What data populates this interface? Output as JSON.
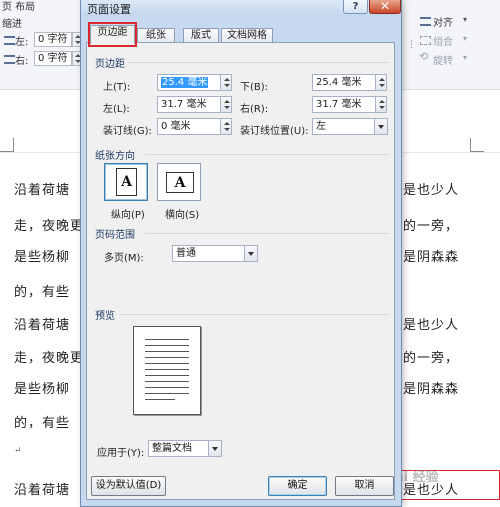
{
  "ribbon": {
    "tab_partial": "页  布局",
    "indent_label": "缩进",
    "left_label": "左:",
    "left_value": "0 字符",
    "right_label": "右:",
    "right_value": "0 字符",
    "align_label": "对齐",
    "group_label": "组合",
    "rotate_label": "旋转"
  },
  "document": {
    "left_lines": [
      "沿着荷塘",
      "走，夜晚更",
      "是些杨柳",
      "的，有些",
      "沿着荷塘",
      "走，夜晚更",
      "是些杨柳",
      "的，有些",
      "↵",
      "沿着荷塘"
    ],
    "right_lines": [
      "是也少人",
      "的一旁，",
      "是阴森森",
      "是也少人",
      "的一旁，",
      "是阴森森",
      "是也少人"
    ]
  },
  "dialog": {
    "title": "页面设置",
    "help": "?",
    "close": "✕",
    "tabs": [
      "页边距",
      "纸张",
      "版式",
      "文档网格"
    ],
    "margins": {
      "section": "页边距",
      "top_label": "上(T):",
      "top_value": "25.4 毫米",
      "bottom_label": "下(B):",
      "bottom_value": "25.4 毫米",
      "left_label": "左(L):",
      "left_value": "31.7 毫米",
      "right_label": "右(R):",
      "right_value": "31.7 毫米",
      "gutter_label": "装订线(G):",
      "gutter_value": "0 毫米",
      "gutter_pos_label": "装订线位置(U):",
      "gutter_pos_value": "左"
    },
    "orientation": {
      "section": "纸张方向",
      "portrait_glyph": "A",
      "landscape_glyph": "A",
      "portrait_label": "纵向(P)",
      "landscape_label": "横向(S)"
    },
    "pages": {
      "section": "页码范围",
      "multiple_label": "多页(M):",
      "multiple_value": "普通"
    },
    "preview": {
      "section": "预览",
      "apply_label": "应用于(Y):",
      "apply_value": "整篇文档"
    },
    "buttons": {
      "default": "设为默认值(D)",
      "ok": "确定",
      "cancel": "取消"
    }
  },
  "watermark": "Bai 经验",
  "colors": {
    "highlight": "#d9292e",
    "dialog_frame": "#c6d9ee",
    "selection": "#3399ff"
  }
}
